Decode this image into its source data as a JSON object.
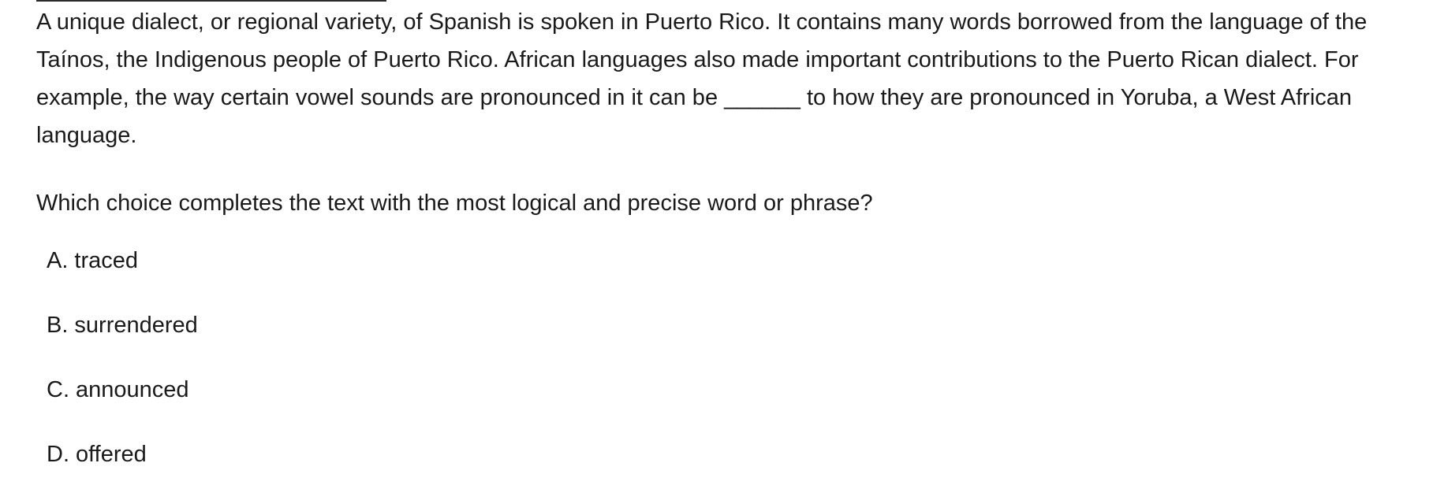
{
  "passage": {
    "text": "A unique dialect, or regional variety, of Spanish is spoken in Puerto Rico. It contains many words borrowed from the language of the Taínos, the Indigenous people of Puerto Rico. African languages also made important contributions to the Puerto Rican dialect. For example, the way certain vowel sounds are pronounced in it can be ______ to how they are pronounced in Yoruba, a West African language."
  },
  "question": {
    "text": "Which choice completes the text with the most logical and precise word or phrase?"
  },
  "choices": [
    {
      "letter": "A.",
      "text": "traced"
    },
    {
      "letter": "B.",
      "text": "surrendered"
    },
    {
      "letter": "C.",
      "text": "announced"
    },
    {
      "letter": "D.",
      "text": "offered"
    }
  ]
}
